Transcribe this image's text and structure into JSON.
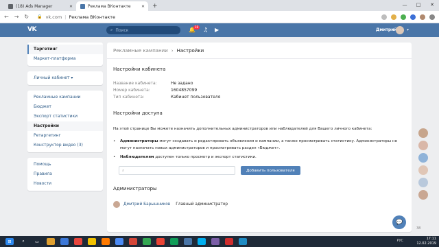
{
  "browser": {
    "tabs": [
      {
        "title": "(18) Ads Manager",
        "color": "#5f6368"
      },
      {
        "title": "Реклама ВКонтакте",
        "color": "#4a76a8"
      }
    ],
    "new_tab": "+",
    "url_host": "vk.com",
    "url_title": "Реклама ВКонтакте",
    "window_controls": [
      "—",
      "□",
      "✕"
    ]
  },
  "vk": {
    "logo": "VK",
    "search_placeholder": "Поиск",
    "notif_count": "18",
    "user_name": "Дмитрий"
  },
  "sidebar": {
    "block1": [
      "Таргетинг",
      "Маркет-платформа"
    ],
    "block2": [
      "Личный кабинет ▾"
    ],
    "block3": [
      "Рекламные кампании",
      "Бюджет",
      "Экспорт статистики",
      "Настройки",
      "Ретаргетинг",
      "Конструктор видео (3)"
    ],
    "block4": [
      "Помощь",
      "Правила",
      "Новости"
    ]
  },
  "main": {
    "breadcrumb_parent": "Рекламные кампании",
    "breadcrumb_current": "Настройки",
    "cabinet_title": "Настройки кабинета",
    "rows": [
      {
        "label": "Название кабинета:",
        "value": "Не задано"
      },
      {
        "label": "Номер кабинета:",
        "value": "1604857099"
      },
      {
        "label": "Тип кабинета:",
        "value": "Кабинет пользователя"
      }
    ],
    "access_title": "Настройки доступа",
    "access_desc": "На этой странице Вы можете назначить дополнительных администраторов или наблюдателей для Вашего личного кабинета:",
    "bullet1_bold": "Администраторы",
    "bullet1_text": " могут создавать и редактировать объявления и кампании, а также просматривать статистику. Администраторы не могут назначать новых администраторов и просматривать раздел «Бюджет».",
    "bullet2_bold": "Наблюдателям",
    "bullet2_text": " доступен только просмотр и экспорт статистики.",
    "add_button": "Добавить пользователя",
    "admins_title": "Администраторы",
    "admin_name": "Дмитрий Барышников",
    "admin_role": "Главный администратор"
  },
  "floating": {
    "badge": "38"
  },
  "taskbar": {
    "time": "17:11",
    "date": "12.02.2019",
    "lang": "РУС"
  }
}
